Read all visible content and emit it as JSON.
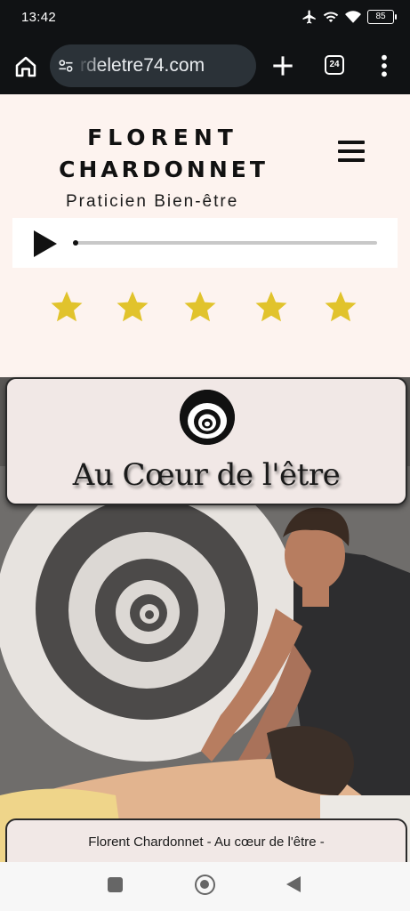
{
  "status_bar": {
    "time": "13:42",
    "battery": "85"
  },
  "browser": {
    "url": "rdeletre74.com",
    "tab_count": "24"
  },
  "site": {
    "brand_line1": "FLORENT",
    "brand_line2": "CHARDONNET",
    "subtitle": "Praticien Bien-être"
  },
  "audio": {
    "progress": 0.01
  },
  "rating": {
    "stars": 5,
    "star_color": "#e1c32c"
  },
  "hero": {
    "title": "Au Cœur de l'être",
    "caption": "Florent Chardonnet - Au cœur de l'être -"
  },
  "colors": {
    "page_bg": "#fdf3ef",
    "card_bg": "#f1e8e6",
    "chrome": "#101214"
  }
}
